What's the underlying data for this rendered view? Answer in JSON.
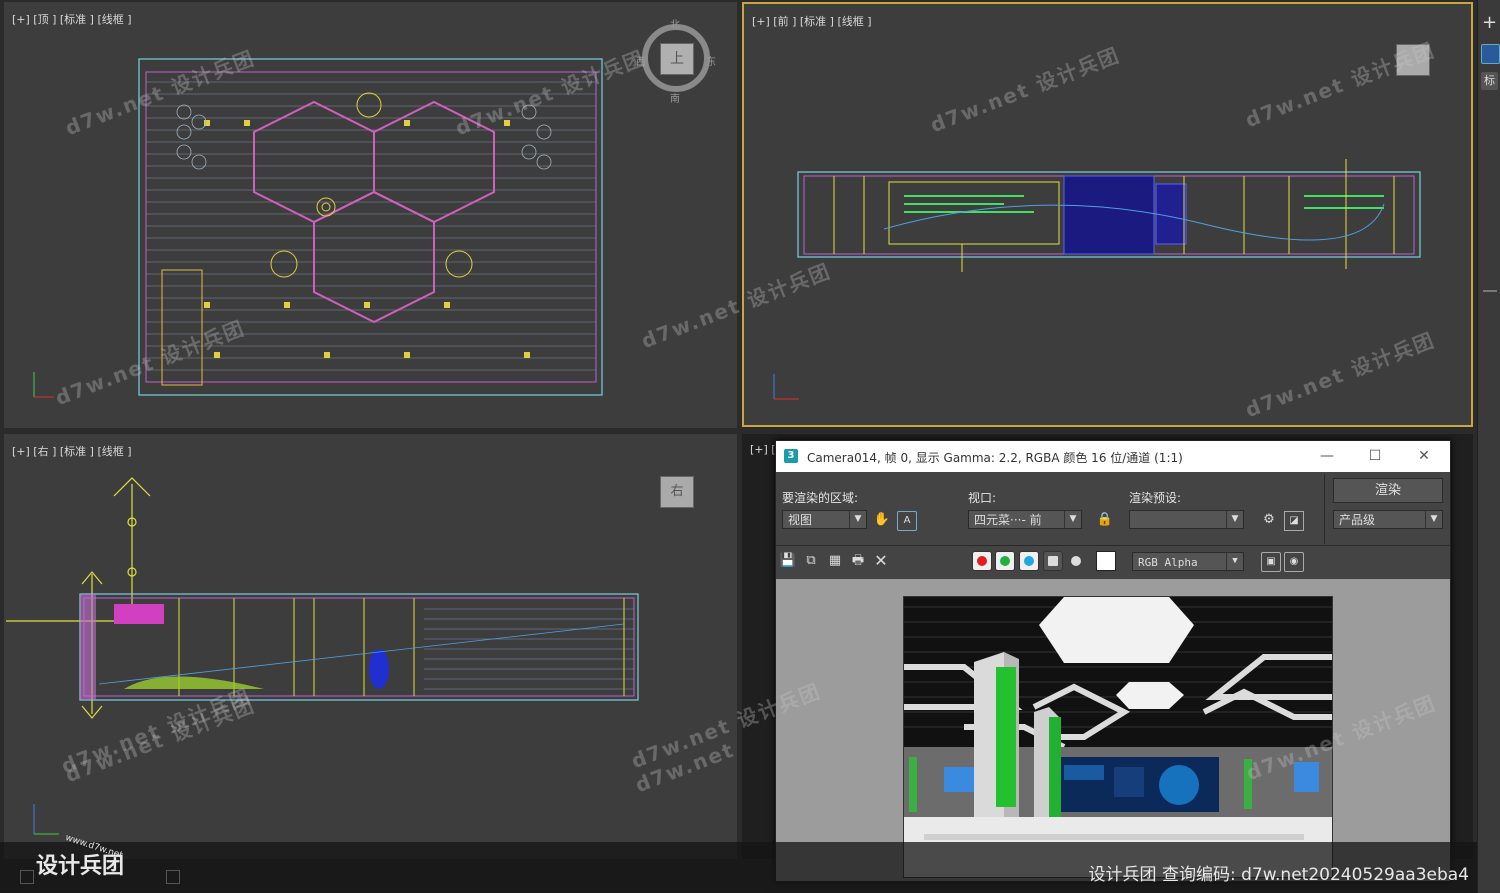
{
  "viewports": {
    "top": {
      "label": "[+] [顶 ] [标准 ] [线框 ]",
      "cube_face": "上",
      "compass": [
        "北",
        "东",
        "南",
        "西"
      ]
    },
    "front": {
      "label": "[+] [前 ] [标准 ] [线框 ]"
    },
    "right": {
      "label": "[+] [右 ] [标准 ] [线框 ]",
      "cube_face": "右"
    },
    "persp": {
      "label": "[+] ["
    }
  },
  "watermark": "d7w.net 设计兵团",
  "render_window": {
    "title": "Camera014, 帧 0, 显示 Gamma: 2.2, RGBA 颜色 16 位/通道 (1:1)",
    "window_buttons": [
      "—",
      "☐",
      "✕"
    ],
    "area_label": "要渲染的区域:",
    "area_value": "视图",
    "viewport_label": "视口:",
    "viewport_value": "四元菜···- 前",
    "preset_label": "渲染预设:",
    "preset_value": "",
    "render_button": "渲染",
    "quality_value": "产品级",
    "channel_value": "RGB Alpha"
  },
  "colors": {
    "red": "#e02020",
    "green": "#20b040",
    "blue": "#20a8e0",
    "accent": "#c8a640"
  },
  "sidebar": {
    "plus": "+",
    "tab": "标"
  },
  "footer": {
    "query_text": "设计兵团  查询编码: d7w.net20240529aa3eba4",
    "logo_text": "设计兵团",
    "logo_url_text": "www.d7w.net"
  }
}
